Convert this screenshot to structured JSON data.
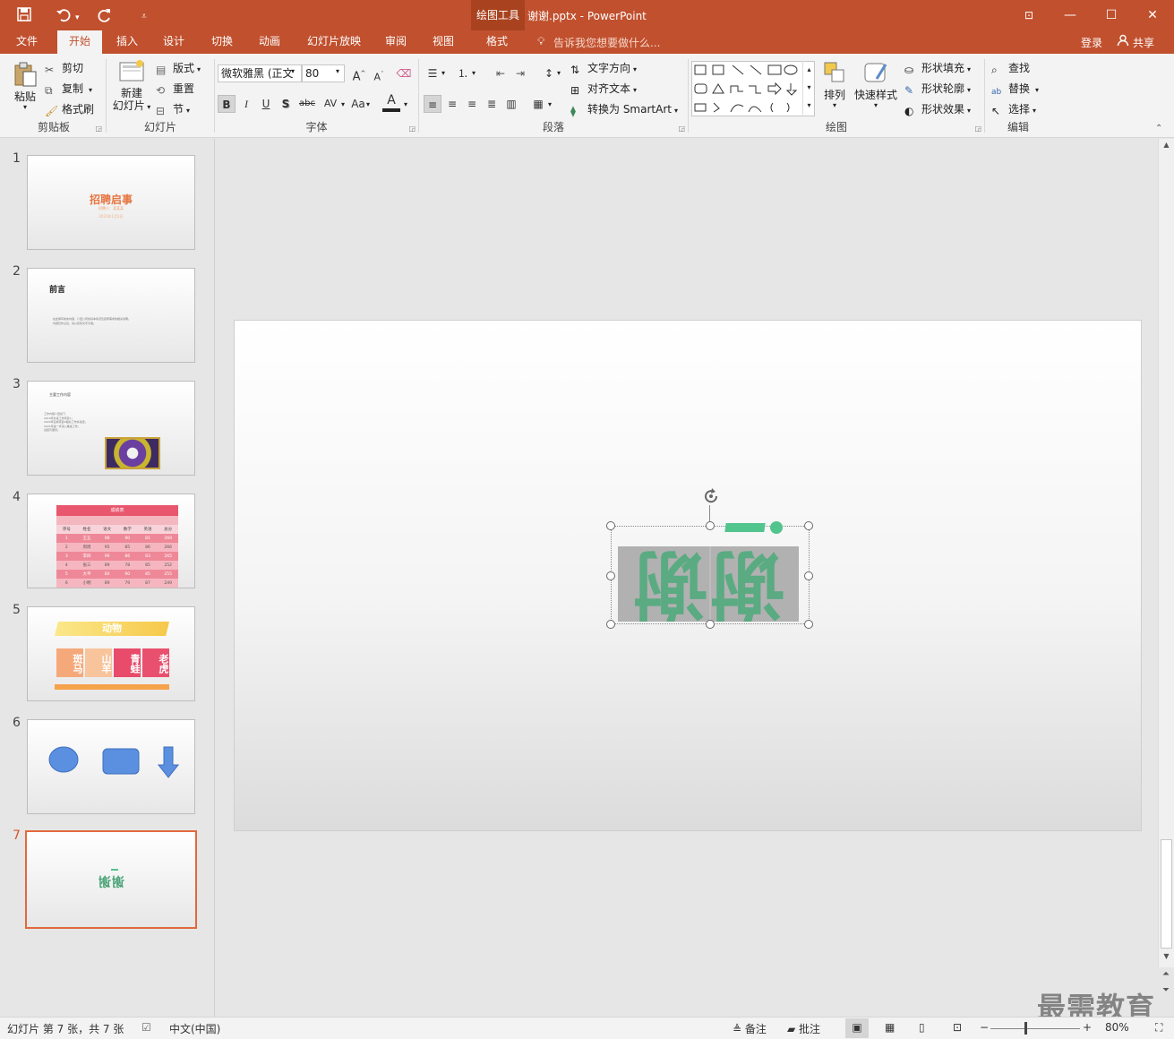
{
  "window": {
    "context_group": "绘图工具",
    "title": "谢谢.pptx - PowerPoint",
    "restore_ribbon_icon": "ribbon-display-icon",
    "minimize": "—",
    "maximize": "☐",
    "close": "✕"
  },
  "tabs": [
    "文件",
    "开始",
    "插入",
    "设计",
    "切换",
    "动画",
    "幻灯片放映",
    "审阅",
    "视图",
    "格式"
  ],
  "active_tab": "开始",
  "tell_me": "告诉我您想要做什么...",
  "signin": "登录",
  "share": "共享",
  "ribbon": {
    "clipboard": {
      "paste": "粘贴",
      "cut": "剪切",
      "copy": "复制",
      "format_painter": "格式刷",
      "label": "剪贴板"
    },
    "slides": {
      "new_slide_line1": "新建",
      "new_slide_line2": "幻灯片",
      "layout": "版式",
      "reset": "重置",
      "section": "节",
      "label": "幻灯片"
    },
    "font": {
      "font_name": "微软雅黑 (正文",
      "font_size": "80",
      "bold": "B",
      "italic": "I",
      "underline": "U",
      "shadow": "S",
      "strike": "abc",
      "spacing": "AV",
      "case": "Aa",
      "color": "A",
      "grow": "A",
      "shrink": "A",
      "label": "字体"
    },
    "paragraph": {
      "text_direction": "文字方向",
      "align_text": "对齐文本",
      "convert_smartart": "转换为 SmartArt",
      "label": "段落"
    },
    "drawing": {
      "arrange": "排列",
      "quick_styles": "快速样式",
      "shape_fill": "形状填充",
      "shape_outline": "形状轮廓",
      "shape_effects": "形状效果",
      "label": "绘图"
    },
    "editing": {
      "find": "查找",
      "replace": "替换",
      "select": "选择",
      "label": "编辑"
    }
  },
  "slides": [
    {
      "num": "1",
      "title": "招聘启事",
      "sub1": "招聘人：某某某",
      "sub2": "2021年1月1日"
    },
    {
      "num": "2",
      "title": "前言",
      "body1": "在此撰写前言内容，介绍公司的基本情况及招聘需求的相关说明。",
      "body2": "内容仅作占位，请以实际文字为准。"
    },
    {
      "num": "3",
      "title": "主要工作内容",
      "lines": [
        "工作内容介绍如下：",
        "2019年负责工作项目1；",
        "2020年完成项目2相关工作并总结；",
        "2021年进一步深入推进工作；",
        "总结与展望。"
      ]
    },
    {
      "num": "4",
      "table_title": "成绩表",
      "headers": [
        "序号",
        "姓名",
        "语文",
        "数学",
        "英语",
        "总分"
      ],
      "rows": [
        [
          "1",
          "王五",
          "98",
          "90",
          "81",
          "269"
        ],
        [
          "2",
          "周周",
          "95",
          "85",
          "86",
          "266"
        ],
        [
          "3",
          "李四",
          "96",
          "86",
          "83",
          "265"
        ],
        [
          "4",
          "张三",
          "89",
          "78",
          "85",
          "252"
        ],
        [
          "5",
          "大平",
          "80",
          "90",
          "85",
          "255"
        ],
        [
          "6",
          "小明",
          "89",
          "79",
          "87",
          "249"
        ]
      ]
    },
    {
      "num": "5",
      "banner": "动物",
      "cells": [
        "斑马",
        "山羊",
        "青蛙",
        "老虎"
      ]
    },
    {
      "num": "6"
    },
    {
      "num": "7",
      "text": "谢谢"
    }
  ],
  "main_slide": {
    "text": "谢谢"
  },
  "status": {
    "slide_info": "幻灯片 第 7 张，共 7 张",
    "language": "中文(中国)",
    "notes": "备注",
    "comments": "批注",
    "zoom": "80%",
    "minus": "−",
    "plus": "+"
  },
  "watermark": "最需教育",
  "colors": {
    "accent": "#c1502e",
    "selection": "#e2683c",
    "green_text": "#4aa376",
    "green_shape": "#52c48e"
  }
}
